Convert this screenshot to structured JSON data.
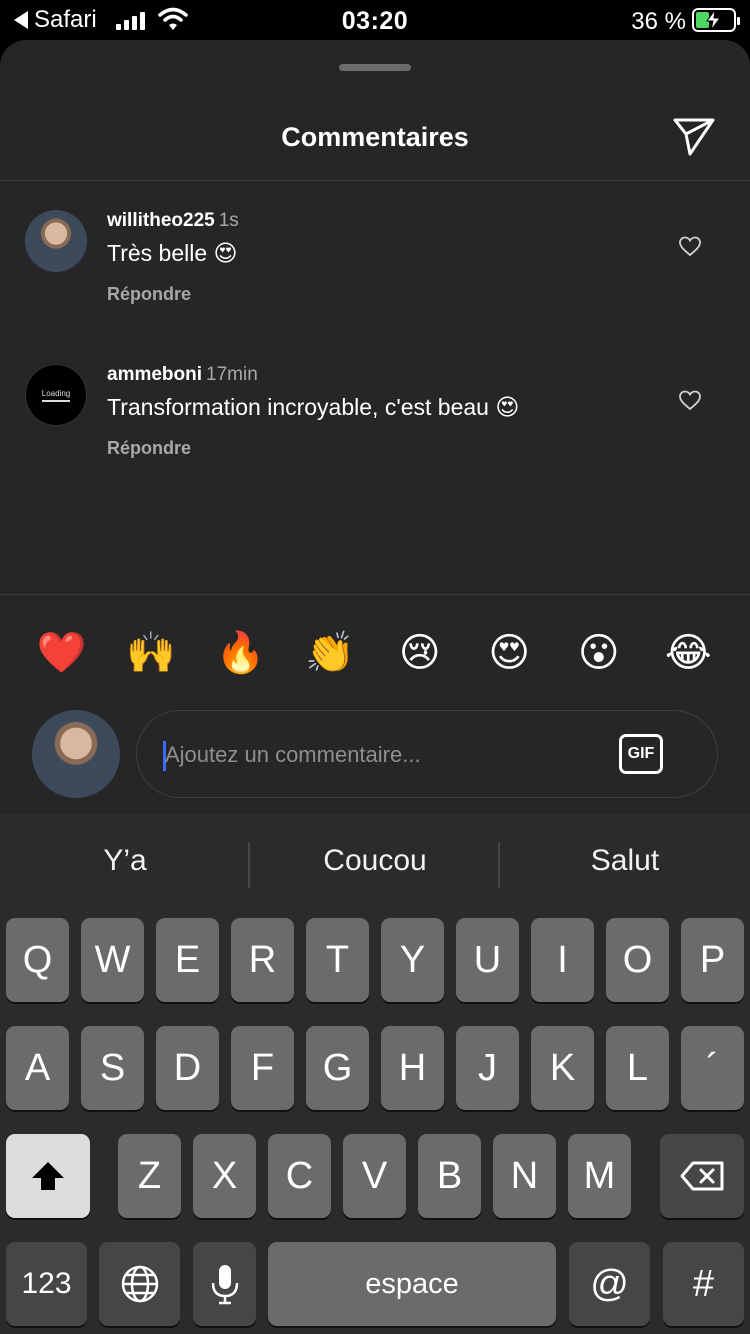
{
  "status_bar": {
    "back_app": "Safari",
    "time": "03:20",
    "battery_percent": "36 %",
    "battery_level": 0.36
  },
  "sheet": {
    "title": "Commentaires"
  },
  "comments": [
    {
      "username": "willitheo225",
      "time": "1s",
      "text": "Très belle 😍",
      "reply_label": "Répondre",
      "avatar": "photo"
    },
    {
      "username": "ammeboni",
      "time": "17min",
      "text": "Transformation incroyable, c'est beau 😍",
      "reply_label": "Répondre",
      "avatar": "loading",
      "avatar_text": "Loading"
    }
  ],
  "quick_emojis": [
    "❤️",
    "🙌",
    "🔥",
    "👏",
    "😢",
    "😍",
    "😮",
    "😂"
  ],
  "comment_input": {
    "placeholder": "Ajoutez un commentaire...",
    "gif_label": "GIF"
  },
  "keyboard": {
    "suggestions": [
      "Y’a",
      "Coucou",
      "Salut"
    ],
    "row1": [
      "Q",
      "W",
      "E",
      "R",
      "T",
      "Y",
      "U",
      "I",
      "O",
      "P"
    ],
    "row2": [
      "A",
      "S",
      "D",
      "F",
      "G",
      "H",
      "J",
      "K",
      "L",
      "´"
    ],
    "row3": [
      "Z",
      "X",
      "C",
      "V",
      "B",
      "N",
      "M"
    ],
    "numbers_label": "123",
    "space_label": "espace",
    "at_label": "@",
    "hash_label": "#"
  },
  "icons": {
    "send": "paper-plane-icon",
    "heart": "heart-outline-icon",
    "shift": "shift-arrow-icon",
    "delete": "backspace-icon",
    "globe": "globe-icon",
    "mic": "microphone-icon"
  }
}
